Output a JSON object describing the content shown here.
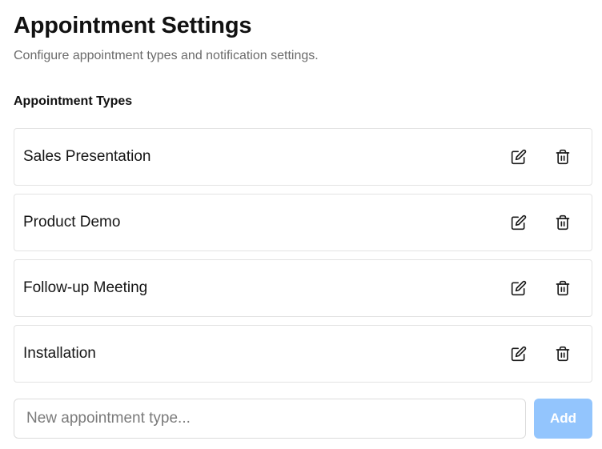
{
  "header": {
    "title": "Appointment Settings",
    "subtitle": "Configure appointment types and notification settings."
  },
  "types_section": {
    "heading": "Appointment Types",
    "items": [
      {
        "label": "Sales Presentation",
        "edit_icon": "edit-icon",
        "delete_icon": "trash-icon"
      },
      {
        "label": "Product Demo",
        "edit_icon": "edit-icon",
        "delete_icon": "trash-icon"
      },
      {
        "label": "Follow-up Meeting",
        "edit_icon": "edit-icon",
        "delete_icon": "trash-icon"
      },
      {
        "label": "Installation",
        "edit_icon": "edit-icon",
        "delete_icon": "trash-icon"
      }
    ]
  },
  "add_form": {
    "placeholder": "New appointment type...",
    "value": "",
    "button_label": "Add",
    "button_disabled": true
  },
  "colors": {
    "add_button_disabled": "#93c5fd",
    "text_primary": "#111111",
    "text_muted": "#6b6b6b",
    "border": "#e3e3e3"
  }
}
